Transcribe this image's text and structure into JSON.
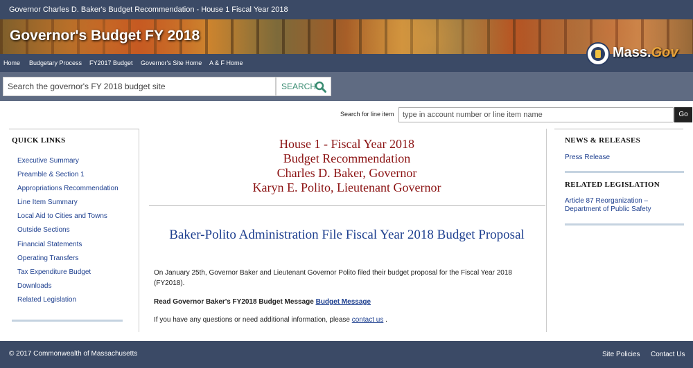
{
  "topbar": {
    "title": "Governor Charles D. Baker's Budget Recommendation - House 1 Fiscal Year 2018"
  },
  "banner": {
    "title": "Governor's Budget FY 2018"
  },
  "logo": {
    "mass": "Mass.",
    "gov": "Gov"
  },
  "nav": {
    "items": [
      {
        "label": "Home"
      },
      {
        "label": "Budgetary Process"
      },
      {
        "label": "FY2017 Budget"
      },
      {
        "label": "Governor's Site Home"
      },
      {
        "label": "A & F Home"
      }
    ]
  },
  "search": {
    "placeholder": "Search the governor's FY 2018 budget site",
    "button_label": "SEARCH"
  },
  "line_item_search": {
    "label": "Search for line item",
    "placeholder": "type in account number or line item name",
    "go_label": "Go"
  },
  "quick_links": {
    "title": "QUICK LINKS",
    "items": [
      {
        "label": "Executive Summary"
      },
      {
        "label": "Preamble & Section 1"
      },
      {
        "label": "Appropriations Recommendation"
      },
      {
        "label": "Line Item Summary"
      },
      {
        "label": "Local Aid to Cities and Towns"
      },
      {
        "label": "Outside Sections"
      },
      {
        "label": "Financial Statements"
      },
      {
        "label": "Operating Transfers"
      },
      {
        "label": "Tax Expenditure Budget"
      },
      {
        "label": "Downloads"
      },
      {
        "label": "Related Legislation"
      }
    ]
  },
  "main": {
    "heading_lines": [
      "House 1 - Fiscal Year 2018",
      "Budget Recommendation",
      "Charles D. Baker, Governor",
      "Karyn E. Polito, Lieutenant Governor"
    ],
    "subheading": "Baker-Polito Administration File Fiscal Year 2018 Budget Proposal",
    "paragraph1": "On January 25th, Governor Baker and Lieutenant Governor Polito filed their budget proposal for the Fiscal Year 2018 (FY2018).",
    "budget_message_text": "Read Governor Baker's FY2018 Budget Message",
    "budget_message_link": "Budget Message",
    "contact_text": "If you have any questions or need additional information, please",
    "contact_link": "contact us",
    "contact_end": "."
  },
  "news": {
    "title": "NEWS & RELEASES",
    "link": "Press Release"
  },
  "related_legislation": {
    "title": "RELATED LEGISLATION",
    "link": "Article 87 Reorganization – Department of Public Safety"
  },
  "footer": {
    "copyright": "© 2017 Commonwealth of Massachusetts",
    "site_policies": "Site Policies",
    "contact_us": "Contact Us"
  },
  "colors": {
    "nav_bg": "#3b4a66",
    "search_bg": "#5f6b82",
    "heading_red": "#8b1212",
    "link_blue": "#1d3f8f",
    "search_green": "#3a8c72"
  }
}
